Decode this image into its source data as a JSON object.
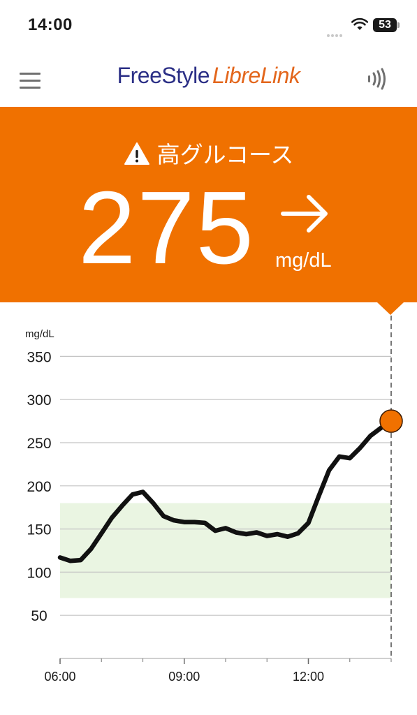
{
  "status_bar": {
    "time": "14:00",
    "battery": "53"
  },
  "header": {
    "logo_part1": "FreeStyle",
    "logo_part2": "LibreLink"
  },
  "reading": {
    "alert_label": "高グルコース",
    "value": "275",
    "unit": "mg/dL",
    "trend": "rising",
    "color": "#f07100"
  },
  "chart_data": {
    "type": "line",
    "ylabel": "mg/dL",
    "ylim": [
      0,
      350
    ],
    "y_ticks": [
      350,
      300,
      250,
      200,
      150,
      100,
      50
    ],
    "x_ticks": [
      "06:00",
      "09:00",
      "12:00"
    ],
    "target_range": [
      70,
      180
    ],
    "target_color": "#eaf5e2",
    "line_color": "#111111",
    "marker_color": "#f07100",
    "series": [
      {
        "x": [
          "06:00",
          "06:15",
          "06:30",
          "06:45",
          "07:00",
          "07:15",
          "07:30",
          "07:45",
          "08:00",
          "08:15",
          "08:30",
          "08:45",
          "09:00",
          "09:15",
          "09:30",
          "09:45",
          "10:00",
          "10:15",
          "10:30",
          "10:45",
          "11:00",
          "11:15",
          "11:30",
          "11:45",
          "12:00",
          "12:15",
          "12:30",
          "12:45",
          "13:00",
          "13:15",
          "13:30",
          "13:45",
          "14:00"
        ],
        "y": [
          117,
          113,
          114,
          127,
          145,
          163,
          177,
          190,
          193,
          180,
          165,
          160,
          158,
          158,
          157,
          148,
          151,
          146,
          144,
          146,
          142,
          144,
          141,
          145,
          157,
          188,
          218,
          234,
          232,
          244,
          258,
          267,
          275
        ]
      }
    ],
    "current": {
      "x": "14:00",
      "y": 275
    }
  }
}
